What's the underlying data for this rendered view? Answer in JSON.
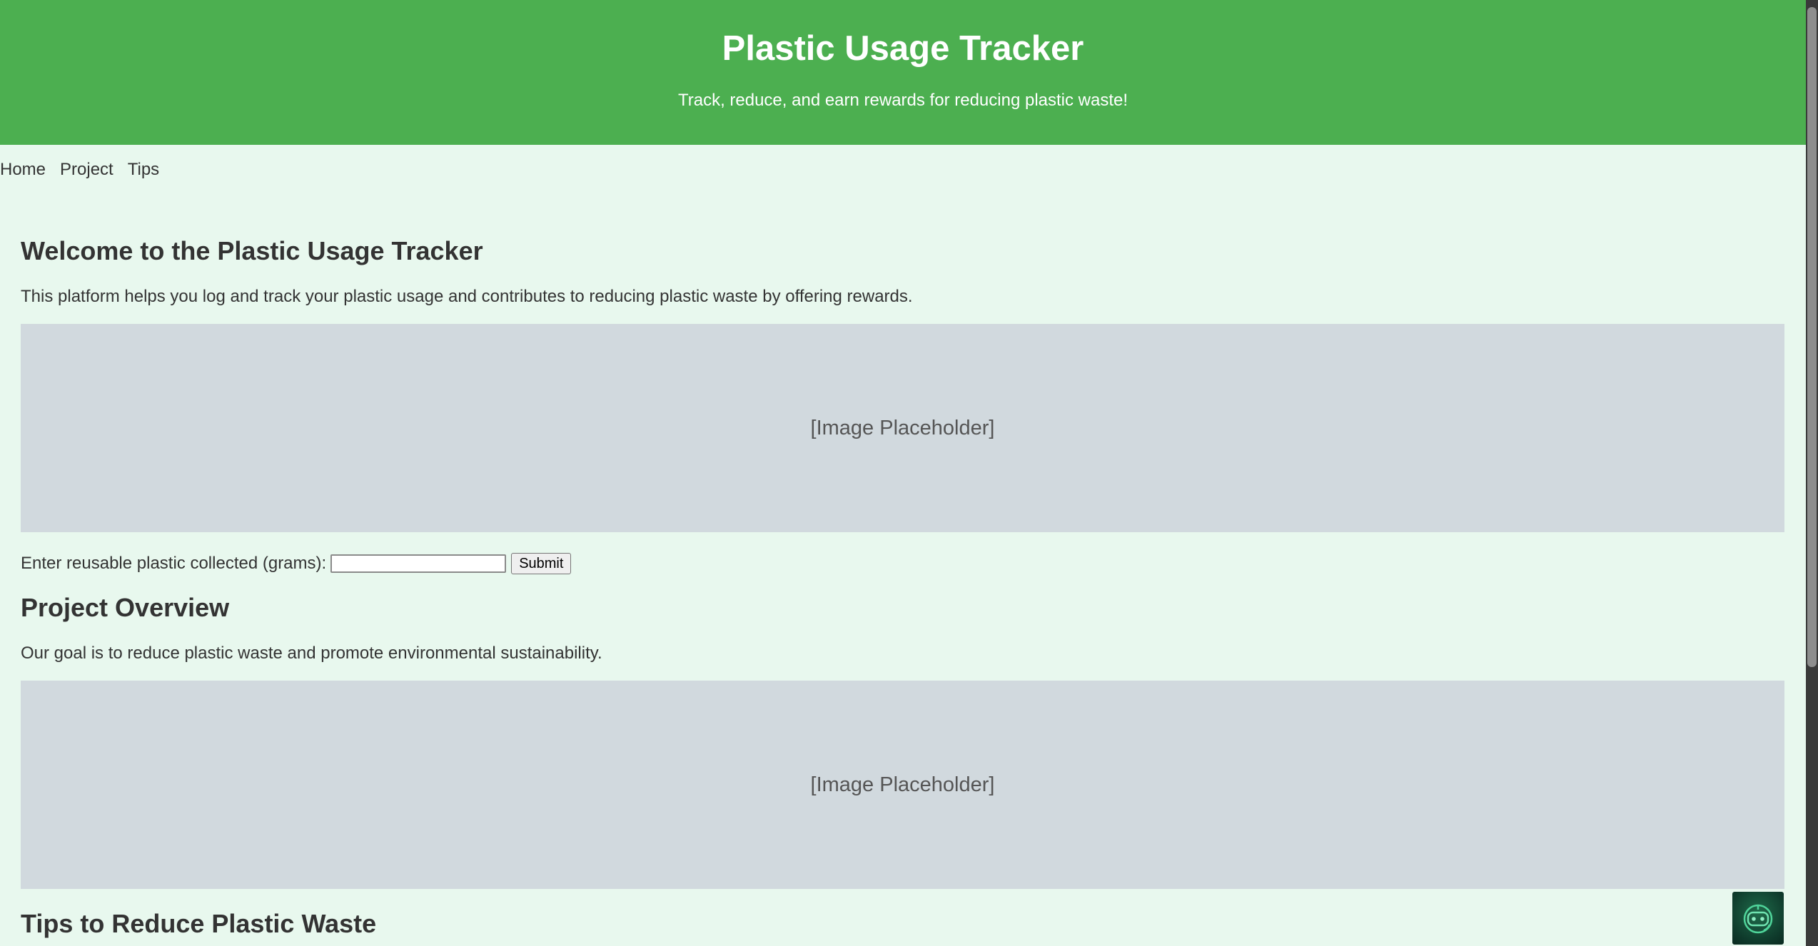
{
  "header": {
    "title": "Plastic Usage Tracker",
    "subtitle": "Track, reduce, and earn rewards for reducing plastic waste!"
  },
  "nav": {
    "items": [
      {
        "label": "Home"
      },
      {
        "label": "Project"
      },
      {
        "label": "Tips"
      }
    ]
  },
  "welcome": {
    "heading": "Welcome to the Plastic Usage Tracker",
    "text": "This platform helps you log and track your plastic usage and contributes to reducing plastic waste by offering rewards.",
    "image_placeholder": "[Image Placeholder]"
  },
  "form": {
    "label": "Enter reusable plastic collected (grams):",
    "input_value": "",
    "submit_label": "Submit"
  },
  "project": {
    "heading": "Project Overview",
    "text": "Our goal is to reduce plastic waste and promote environmental sustainability.",
    "image_placeholder": "[Image Placeholder]"
  },
  "tips": {
    "heading": "Tips to Reduce Plastic Waste"
  },
  "chat_widget": {
    "icon": "robot-icon"
  },
  "colors": {
    "header_bg": "#4caf50",
    "page_bg": "#e8f8ee",
    "placeholder_bg": "#d1d9de"
  }
}
